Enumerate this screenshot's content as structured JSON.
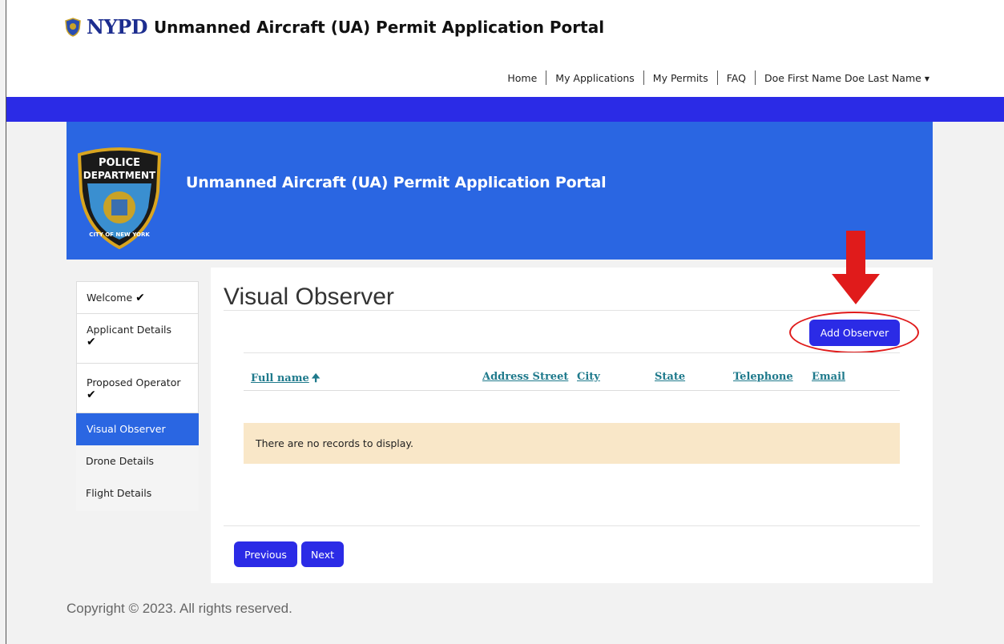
{
  "header": {
    "brand_nypd": "NYPD",
    "brand_title": "Unmanned Aircraft (UA) Permit Application Portal",
    "nav": [
      {
        "label": "Home"
      },
      {
        "label": "My Applications"
      },
      {
        "label": "My Permits"
      },
      {
        "label": "FAQ"
      },
      {
        "label": "Doe First Name Doe Last Name"
      }
    ]
  },
  "hero": {
    "title": "Unmanned Aircraft (UA) Permit Application Portal",
    "logo_text_top": "POLICE",
    "logo_text_mid": "DEPARTMENT",
    "logo_text_bottom": "CITY OF NEW YORK"
  },
  "sidebar": {
    "items": [
      {
        "label": "Welcome",
        "completed": true
      },
      {
        "label": "Applicant Details",
        "completed": true
      },
      {
        "label": "Proposed Operator",
        "completed": true
      },
      {
        "label": "Visual Observer",
        "active": true
      },
      {
        "label": "Drone Details"
      },
      {
        "label": "Flight Details"
      }
    ]
  },
  "main": {
    "title": "Visual Observer",
    "add_button": "Add Observer",
    "columns": [
      {
        "label": "Full name",
        "sorted": "asc"
      },
      {
        "label": "Address Street"
      },
      {
        "label": "City"
      },
      {
        "label": "State"
      },
      {
        "label": "Telephone"
      },
      {
        "label": "Email"
      }
    ],
    "empty_message": "There are no records to display.",
    "previous_button": "Previous",
    "next_button": "Next"
  },
  "footer": {
    "copyright": "Copyright © 2023. All rights reserved."
  },
  "colors": {
    "primary_button": "#2b2be6",
    "hero_blue": "#2a66e2",
    "link_teal": "#1f7a8c",
    "annotation_red": "#e01b1b",
    "empty_bg": "#f9e7c8"
  }
}
